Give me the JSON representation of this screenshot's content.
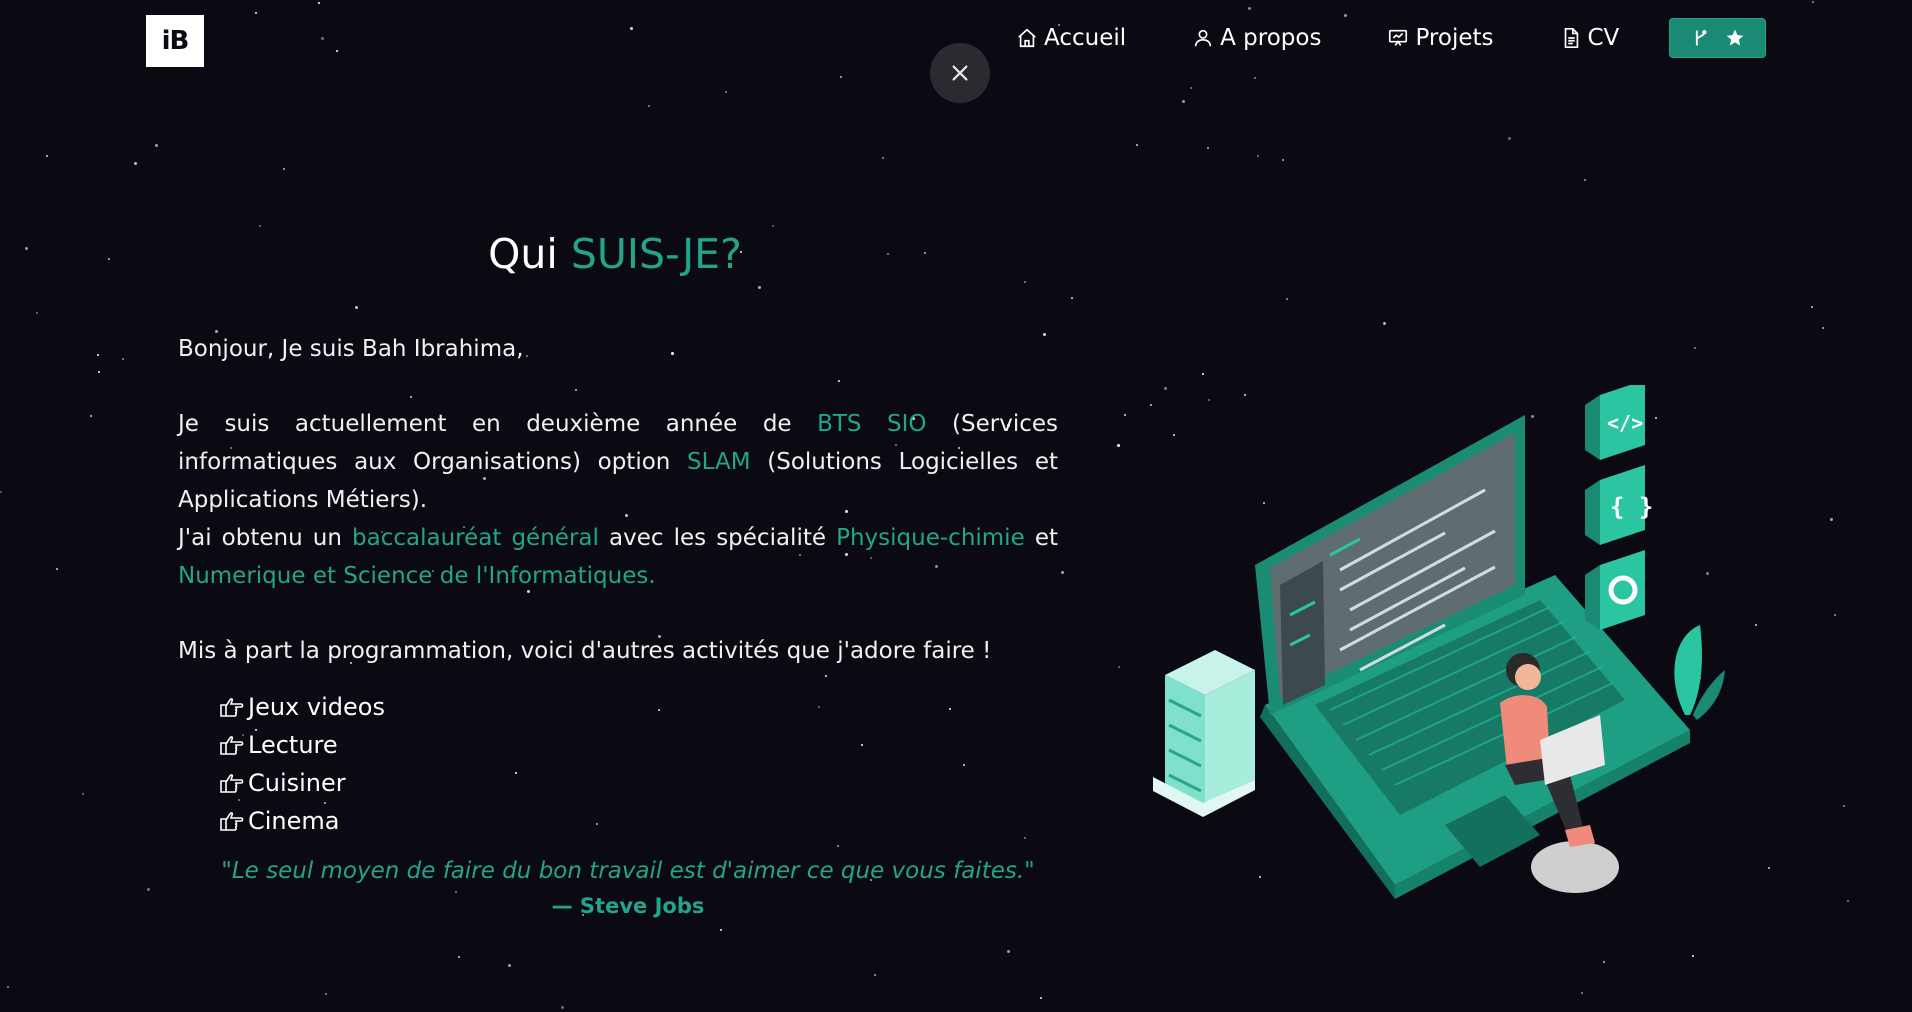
{
  "logo": {
    "text": "iB"
  },
  "nav": {
    "items": [
      {
        "label": "Accueil",
        "icon": "home-icon"
      },
      {
        "label": "A propos",
        "icon": "user-icon"
      },
      {
        "label": "Projets",
        "icon": "presentation-icon"
      },
      {
        "label": "CV",
        "icon": "document-icon"
      }
    ],
    "github_star": {
      "icons": [
        "git-branch-icon",
        "star-icon"
      ]
    }
  },
  "close_button": {
    "icon": "close-icon"
  },
  "about": {
    "heading_prefix": "Qui ",
    "heading_accent": "SUIS-JE?",
    "greeting": "Bonjour, Je suis Bah Ibrahima,",
    "p1_a": "Je suis actuellement en deuxième année de ",
    "p1_hl1": "BTS SIO",
    "p1_b": " (Services informatiques aux Organisations) option ",
    "p1_hl2": "SLAM",
    "p1_c": " (Solutions Logicielles et Applications Métiers).",
    "p2_a": "J'ai obtenu un ",
    "p2_hl1": "baccalauréat général",
    "p2_b": " avec les spécialité ",
    "p2_hl2": "Physique-chimie",
    "p2_c": " et ",
    "p2_hl3": "Numerique et Science de l'Informatiques.",
    "hobbies_intro": "Mis à part la programmation, voici d'autres activités que j'adore faire !",
    "hobbies": [
      "Jeux videos",
      "Lecture",
      "Cuisiner",
      "Cinema"
    ],
    "quote": "\"Le seul moyen de faire du bon travail est d'aimer ce que vous faites.\"",
    "author": "— Steve Jobs"
  },
  "colors": {
    "accent": "#22a58a",
    "background": "#0b0911",
    "button": "#1a8a74"
  }
}
